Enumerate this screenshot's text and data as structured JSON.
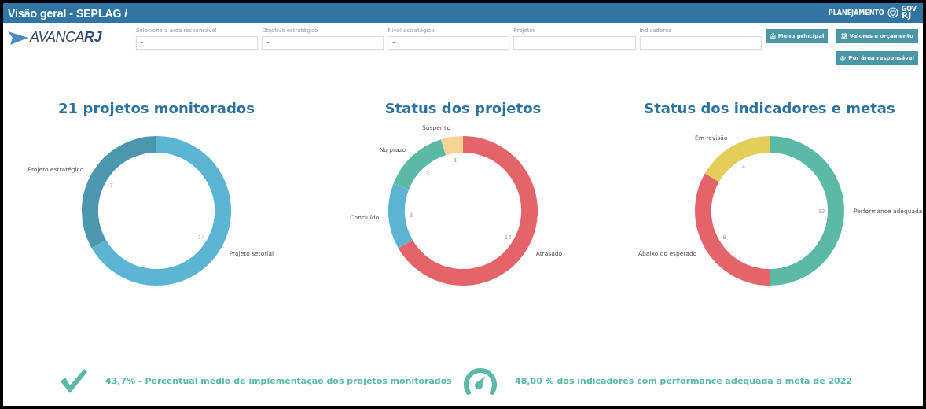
{
  "header": {
    "title": "Visão geral - SEPLAG /",
    "brand": {
      "agency": "PLANEJAMENTO",
      "gov": "GOV",
      "state": "RJ"
    }
  },
  "logo": {
    "text": "AVANCA**RJ**"
  },
  "filters": [
    {
      "label": "Selecione a área responsável",
      "value": "-"
    },
    {
      "label": "Objetivo estratégico",
      "value": "-"
    },
    {
      "label": "Nível estratégico",
      "value": "-"
    },
    {
      "label": "Projetos"
    },
    {
      "label": "Indicadores"
    }
  ],
  "buttons": [
    {
      "label": "Menu principal"
    },
    {
      "label": "Valores e orçamento"
    },
    {
      "label": "Por área responsável"
    }
  ],
  "charts": [
    {
      "chart_data": {
        "type": "donut",
        "title": "21 projetos monitorados",
        "categories": [
          "Projeto setorial",
          "Projeto estratégico"
        ],
        "values": [
          14,
          7
        ],
        "colors": [
          "#5ab4d2",
          "#4a97b0"
        ],
        "data_labels": true
      }
    },
    {
      "chart_data": {
        "type": "donut",
        "title": "Status dos projetos",
        "categories": [
          "Atrasado",
          "Concluído",
          "No prazo",
          "Suspenso"
        ],
        "values": [
          14,
          3,
          3,
          1
        ],
        "colors": [
          "#e5646a",
          "#5ab4d2",
          "#5bb9a5",
          "#f7d494"
        ],
        "data_labels": true
      }
    },
    {
      "chart_data": {
        "type": "donut",
        "title": "Status dos indicadores e metas",
        "categories": [
          "Performance adequada",
          "Abaixo do esperado",
          "Em revisão"
        ],
        "values": [
          12,
          8,
          4
        ],
        "colors": [
          "#5bb9a5",
          "#e5646a",
          "#e5cd5c"
        ],
        "data_labels": true
      }
    }
  ],
  "summary": [
    {
      "text": "43,7% - Percentual médio de implementação dos projetos monitorados"
    },
    {
      "text": "48,00 % dos indicadores com performance adequada a meta de 2022"
    }
  ]
}
